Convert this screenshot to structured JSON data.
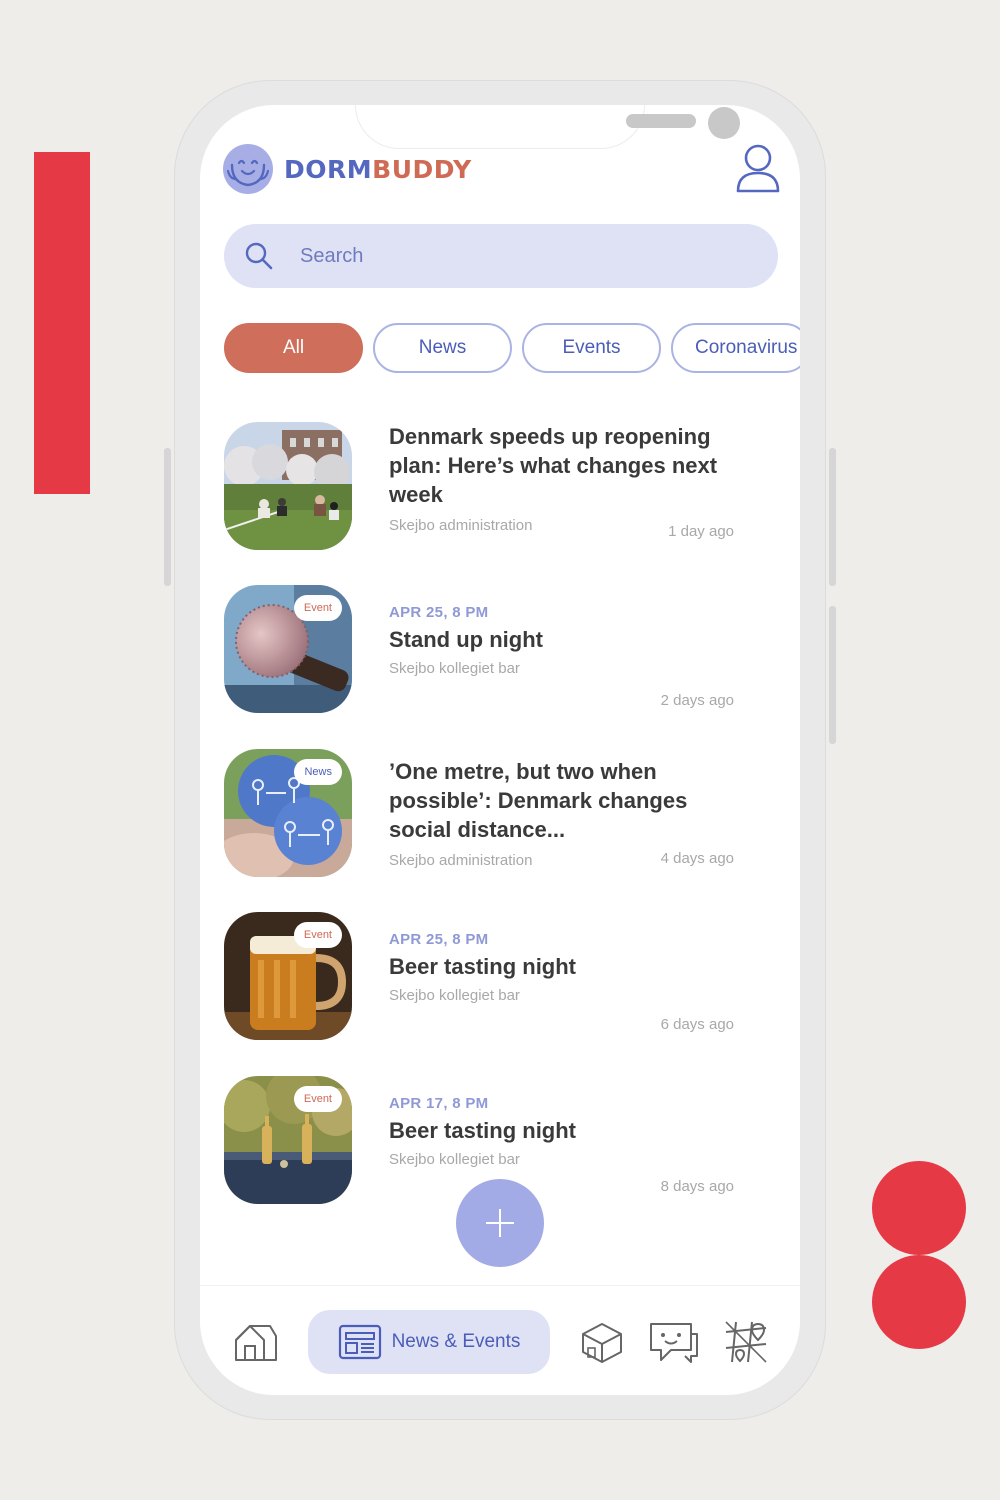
{
  "app": {
    "brand_part1": "DORM",
    "brand_part2": "BUDDY",
    "colors": {
      "primary": "#5468bf",
      "accent": "#cf6e5a",
      "light": "#dfe2f5",
      "fab": "#a3abe6",
      "decor": "#e63946"
    }
  },
  "header": {
    "logo_icon": "smiley-logo-icon",
    "profile_icon": "user-icon"
  },
  "search": {
    "placeholder": "Search",
    "icon": "search-icon"
  },
  "filters": [
    {
      "label": "All",
      "active": true
    },
    {
      "label": "News",
      "active": false
    },
    {
      "label": "Events",
      "active": false
    },
    {
      "label": "Coronavirus",
      "active": false
    }
  ],
  "feed": [
    {
      "type": "news",
      "badge": "",
      "date": "",
      "title": "Denmark speeds up reopening plan: Here’s what changes next week",
      "source": "Skejbo administration",
      "time": "1 day ago",
      "image": "people-on-lawn"
    },
    {
      "type": "event",
      "badge": "Event",
      "date": "APR 25, 8 PM",
      "title": "Stand up night",
      "source": "Skejbo kollegiet bar",
      "time": "2 days ago",
      "image": "microphone"
    },
    {
      "type": "news",
      "badge": "News",
      "date": "",
      "title": "’One metre, but two when possible’: Denmark changes social distance...",
      "source": "Skejbo administration",
      "time": "4 days ago",
      "image": "distance-buttons"
    },
    {
      "type": "event",
      "badge": "Event",
      "date": "APR 25, 8 PM",
      "title": "Beer tasting night",
      "source": "Skejbo kollegiet bar",
      "time": "6 days ago",
      "image": "beer-mug"
    },
    {
      "type": "event",
      "badge": "Event",
      "date": "APR 17, 8 PM",
      "title": "Beer tasting night",
      "source": "Skejbo kollegiet bar",
      "time": "8 days ago",
      "image": "beer-bottles"
    }
  ],
  "fab": {
    "icon": "plus-icon"
  },
  "bottom_nav": {
    "items": [
      {
        "icon": "home-icon"
      },
      {
        "icon": "news-icon",
        "label": "News & Events",
        "active": true
      },
      {
        "icon": "laundry-icon"
      },
      {
        "icon": "chat-icon"
      },
      {
        "icon": "map-icon"
      }
    ]
  }
}
